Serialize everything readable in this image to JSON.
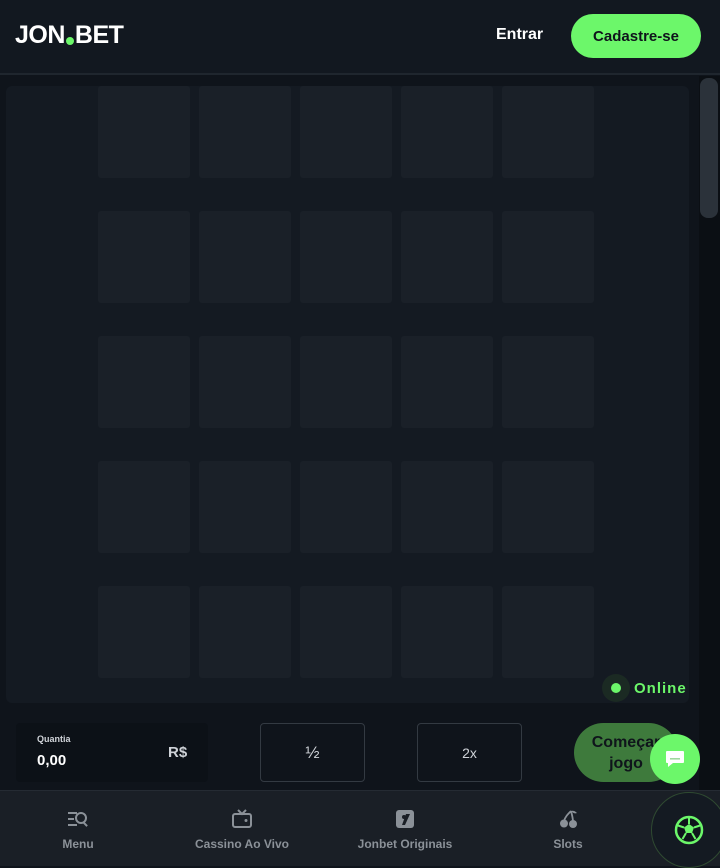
{
  "header": {
    "logo_left": "JON",
    "logo_right": "BET",
    "login_label": "Entrar",
    "signup_label": "Cadastre-se"
  },
  "game": {
    "online_label": "Online",
    "rows": 5,
    "cols": 5
  },
  "controls": {
    "amount_label": "Quantia",
    "amount_value": "0,00",
    "currency": "R$",
    "half_label": "½",
    "double_label": "2x",
    "start_label_line1": "Começar",
    "start_label_line2": "jogo"
  },
  "bottom_nav": {
    "items": [
      {
        "label": "Menu",
        "icon": "menu-search-icon"
      },
      {
        "label": "Cassino Ao Vivo",
        "icon": "tv-icon"
      },
      {
        "label": "Jonbet Originais",
        "icon": "originals-icon"
      },
      {
        "label": "Slots",
        "icon": "cherries-icon"
      }
    ],
    "sports_icon": "soccer-ball-icon"
  },
  "colors": {
    "accent": "#6cf76a",
    "background": "#0f141b",
    "tile": "#1a2028"
  }
}
